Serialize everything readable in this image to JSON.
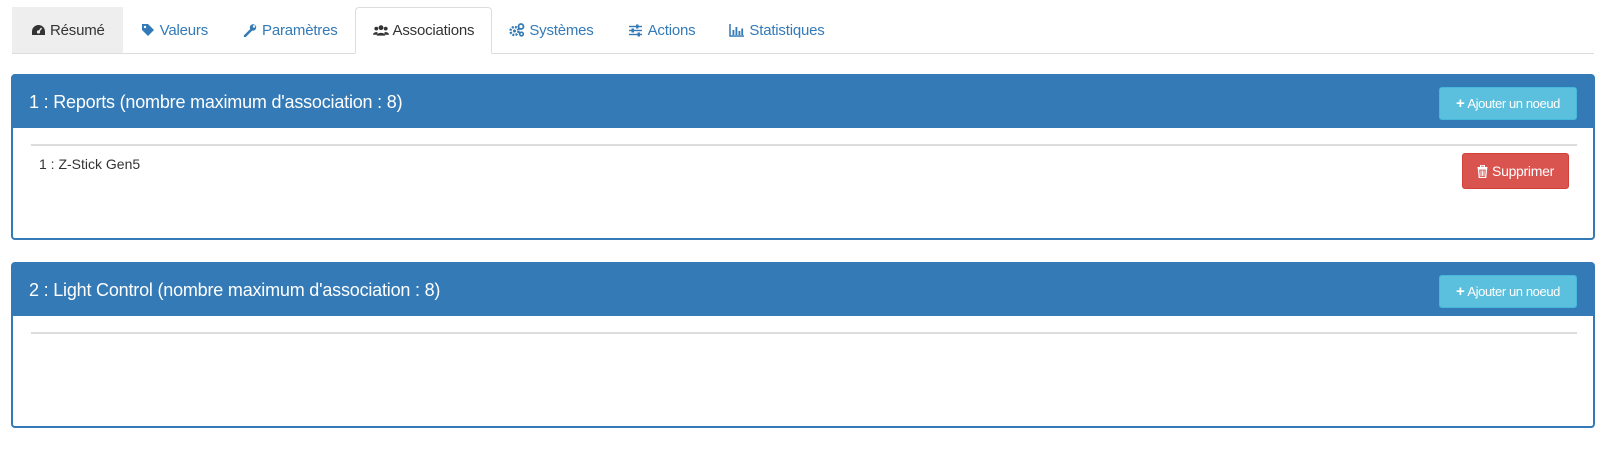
{
  "tabs": [
    {
      "label": "Résumé",
      "icon": "dashboard-icon"
    },
    {
      "label": "Valeurs",
      "icon": "tag-icon"
    },
    {
      "label": "Paramètres",
      "icon": "wrench-icon"
    },
    {
      "label": "Associations",
      "icon": "users-icon"
    },
    {
      "label": "Systèmes",
      "icon": "cogs-icon"
    },
    {
      "label": "Actions",
      "icon": "sliders-icon"
    },
    {
      "label": "Statistiques",
      "icon": "bar-chart-icon"
    }
  ],
  "active_tab": "Associations",
  "groups": [
    {
      "title": "1 : Reports (nombre maximum d'association : 8)",
      "add_label": "Ajouter un noeud",
      "nodes": [
        {
          "label": "1 : Z-Stick Gen5",
          "delete_label": "Supprimer"
        }
      ]
    },
    {
      "title": "2 : Light Control (nombre maximum d'association : 8)",
      "add_label": "Ajouter un noeud",
      "nodes": []
    }
  ],
  "colors": {
    "primary": "#337ab7",
    "info": "#5bc0de",
    "danger": "#d9534f"
  }
}
